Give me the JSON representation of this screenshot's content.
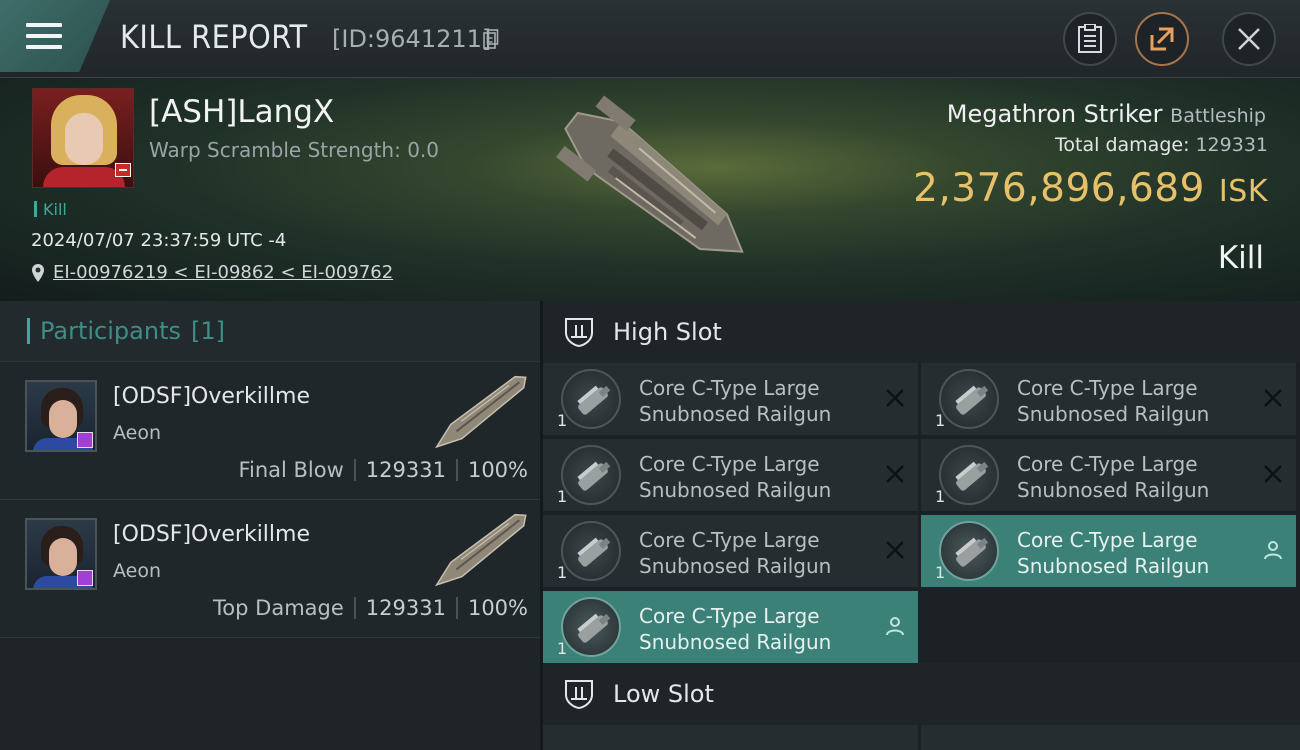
{
  "header": {
    "title": "KILL REPORT",
    "report_id": "[ID:9641211]"
  },
  "victim": {
    "name": "[ASH]LangX",
    "warp_scramble": "Warp Scramble Strength: 0.0",
    "kill_tag": "Kill",
    "datetime": "2024/07/07 23:37:59 UTC -4",
    "location": "EI-00976219 < EI-09862 < EI-009762"
  },
  "ship": {
    "name": "Megathron Striker",
    "class": "Battleship",
    "total_damage_label": "Total damage:",
    "total_damage": "129331",
    "value": "2,376,896,689",
    "value_unit": "ISK",
    "result": "Kill"
  },
  "participants": {
    "label": "Participants",
    "count": "[1]",
    "rows": [
      {
        "name": "[ODSF]Overkillme",
        "corp": "Aeon",
        "role": "Final Blow",
        "damage": "129331",
        "percent": "100%"
      },
      {
        "name": "[ODSF]Overkillme",
        "corp": "Aeon",
        "role": "Top Damage",
        "damage": "129331",
        "percent": "100%"
      }
    ]
  },
  "high_slot": {
    "label": "High Slot",
    "modules": [
      {
        "line1": "Core C-Type Large",
        "line2": "Snubnosed Railgun",
        "qty": "1",
        "status": "destroyed"
      },
      {
        "line1": "Core C-Type Large",
        "line2": "Snubnosed Railgun",
        "qty": "1",
        "status": "destroyed"
      },
      {
        "line1": "Core C-Type Large",
        "line2": "Snubnosed Railgun",
        "qty": "1",
        "status": "destroyed"
      },
      {
        "line1": "Core C-Type Large",
        "line2": "Snubnosed Railgun",
        "qty": "1",
        "status": "destroyed"
      },
      {
        "line1": "Core C-Type Large",
        "line2": "Snubnosed Railgun",
        "qty": "1",
        "status": "destroyed"
      },
      {
        "line1": "Core C-Type Large",
        "line2": "Snubnosed Railgun",
        "qty": "1",
        "status": "dropped"
      },
      {
        "line1": "Core C-Type Large",
        "line2": "Snubnosed Railgun",
        "qty": "1",
        "status": "dropped"
      }
    ]
  },
  "low_slot": {
    "label": "Low Slot"
  },
  "colors": {
    "accent_teal": "#3fa89d",
    "isk_gold": "#e8c06a",
    "dropped_bg": "#3b8178"
  }
}
